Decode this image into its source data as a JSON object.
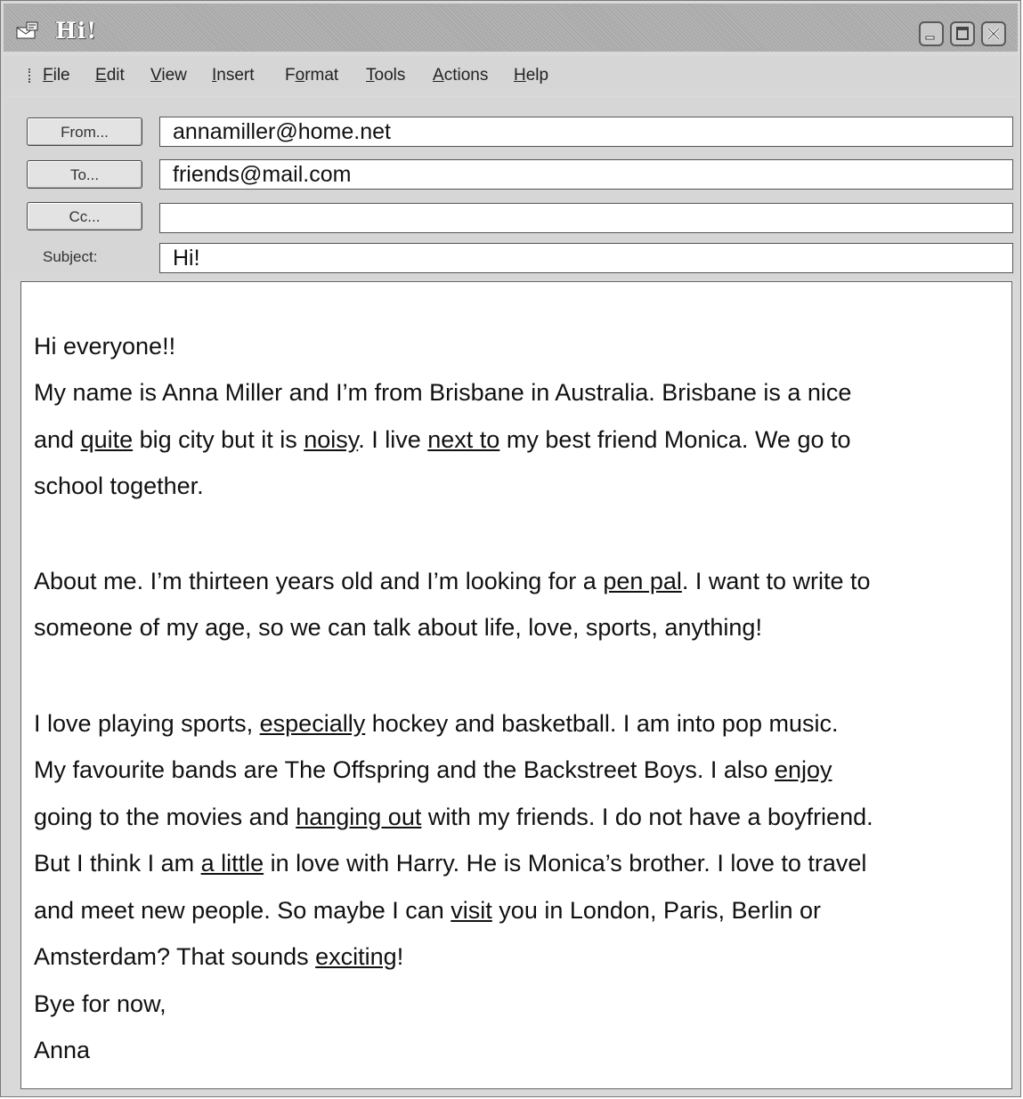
{
  "window": {
    "title": "Hi!",
    "icon": "envelope-compose-icon"
  },
  "menu": {
    "items": [
      {
        "pre": "",
        "mnemonic": "F",
        "post": "ile"
      },
      {
        "pre": "",
        "mnemonic": "E",
        "post": "dit"
      },
      {
        "pre": "",
        "mnemonic": "V",
        "post": "iew"
      },
      {
        "pre": "",
        "mnemonic": "I",
        "post": "nsert"
      },
      {
        "pre": "F",
        "mnemonic": "o",
        "post": "rmat"
      },
      {
        "pre": "",
        "mnemonic": "T",
        "post": "ools"
      },
      {
        "pre": "",
        "mnemonic": "A",
        "post": "ctions"
      },
      {
        "pre": "",
        "mnemonic": "H",
        "post": "elp"
      }
    ]
  },
  "header": {
    "from_label": "From...",
    "to_label": "To...",
    "cc_label": "Cc...",
    "subject_label": "Subject:",
    "from_value": "annamiller@home.net",
    "to_value": "friends@mail.com",
    "cc_value": "",
    "subject_value": "Hi!"
  },
  "body": {
    "lines": [
      [
        {
          "t": "Hi everyone!!"
        }
      ],
      [
        {
          "t": "My name is Anna Miller and I’m from Brisbane in Australia. Brisbane is a nice"
        }
      ],
      [
        {
          "t": "and "
        },
        {
          "t": "quite",
          "u": true
        },
        {
          "t": " big city but it is "
        },
        {
          "t": "noisy",
          "u": true
        },
        {
          "t": ". I live "
        },
        {
          "t": "next to",
          "u": true
        },
        {
          "t": " my best friend Monica. We go to"
        }
      ],
      [
        {
          "t": "school together."
        }
      ],
      [
        {
          "t": "About me. I’m thirteen years old and I’m looking for a "
        },
        {
          "t": "pen pal",
          "u": true
        },
        {
          "t": ". I want to write to"
        }
      ],
      [
        {
          "t": "someone of my age, so we can talk about life, love, sports, anything!"
        }
      ],
      [
        {
          "t": "I love playing sports, "
        },
        {
          "t": "especially",
          "u": true
        },
        {
          "t": " hockey and basketball. I am into pop music."
        }
      ],
      [
        {
          "t": "My favourite bands are The Offspring and the Backstreet Boys. I also "
        },
        {
          "t": "enjoy",
          "u": true
        }
      ],
      [
        {
          "t": "going to the movies and "
        },
        {
          "t": "hanging out",
          "u": true
        },
        {
          "t": " with my friends. I do not have a boyfriend."
        }
      ],
      [
        {
          "t": "But I think I am "
        },
        {
          "t": "a little",
          "u": true
        },
        {
          "t": " in love with Harry. He is Monica’s brother. I love to travel"
        }
      ],
      [
        {
          "t": "and meet new people. So maybe I can "
        },
        {
          "t": "visit",
          "u": true
        },
        {
          "t": " you in London, Paris, Berlin or"
        }
      ],
      [
        {
          "t": "Amsterdam? That sounds "
        },
        {
          "t": "exciting",
          "u": true
        },
        {
          "t": "!"
        }
      ],
      [
        {
          "t": "Bye for now,"
        }
      ],
      [
        {
          "t": "Anna"
        }
      ]
    ]
  }
}
